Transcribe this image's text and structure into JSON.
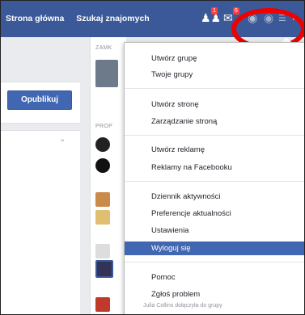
{
  "topbar": {
    "nav": [
      "Strona główna",
      "Szukaj znajomych"
    ],
    "badges": {
      "friends": "1",
      "messages": "6"
    }
  },
  "left": {
    "publish_label": "Opublikuj"
  },
  "mid": {
    "label_top": "ZAMK",
    "label_mid": "PROP"
  },
  "menu": {
    "items": [
      "Utwórz grupę",
      "Twoje grupy",
      "Utwórz stronę",
      "Zarządzanie stroną",
      "Utwórz reklamę",
      "Reklamy na Facebooku",
      "Dziennik aktywności",
      "Preferencje aktualności",
      "Ustawienia",
      "Wyloguj się",
      "Pomoc",
      "Zgłoś problem"
    ],
    "active_index": 9
  },
  "bottom_text": "Julia Collins dołączyła do grupy",
  "colors": {
    "brand": "#3b5998",
    "highlight": "#4267b2",
    "annotation": "#ee0000"
  }
}
